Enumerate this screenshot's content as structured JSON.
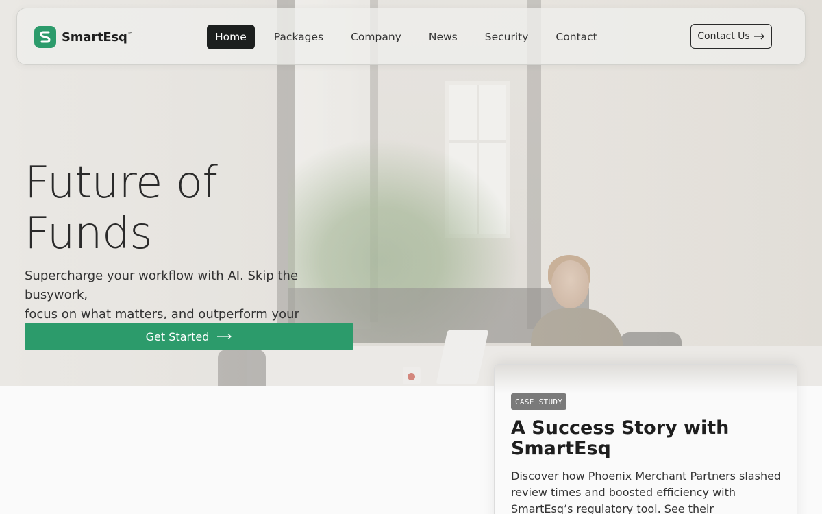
{
  "brand": {
    "name": "SmartEsq",
    "trademark": "™",
    "icon": "smartesq-logo-icon",
    "accent": "#2c9b6b"
  },
  "nav": {
    "items": [
      {
        "label": "Home",
        "active": true
      },
      {
        "label": "Packages",
        "active": false
      },
      {
        "label": "Company",
        "active": false
      },
      {
        "label": "News",
        "active": false
      },
      {
        "label": "Security",
        "active": false
      },
      {
        "label": "Contact",
        "active": false
      }
    ],
    "contact_button": {
      "label": "Contact Us",
      "icon": "arrow-right-icon"
    }
  },
  "hero": {
    "title_line1": "Future of",
    "title_line2": "Funds",
    "subtitle_line1": "Supercharge your workflow with AI. Skip the busywork,",
    "subtitle_line2": "focus on what matters, and outperform your competition.",
    "cta": {
      "label": "Get Started",
      "icon": "long-arrow-right-icon",
      "color": "#2c9b6b"
    }
  },
  "case_study": {
    "badge": "CASE STUDY",
    "title_line1": "A Success Story with",
    "title_line2": "SmartEsq",
    "text": "Discover how Phoenix Merchant Partners slashed review times and boosted efficiency with SmartEsq’s regulatory tool. See their transformation"
  }
}
